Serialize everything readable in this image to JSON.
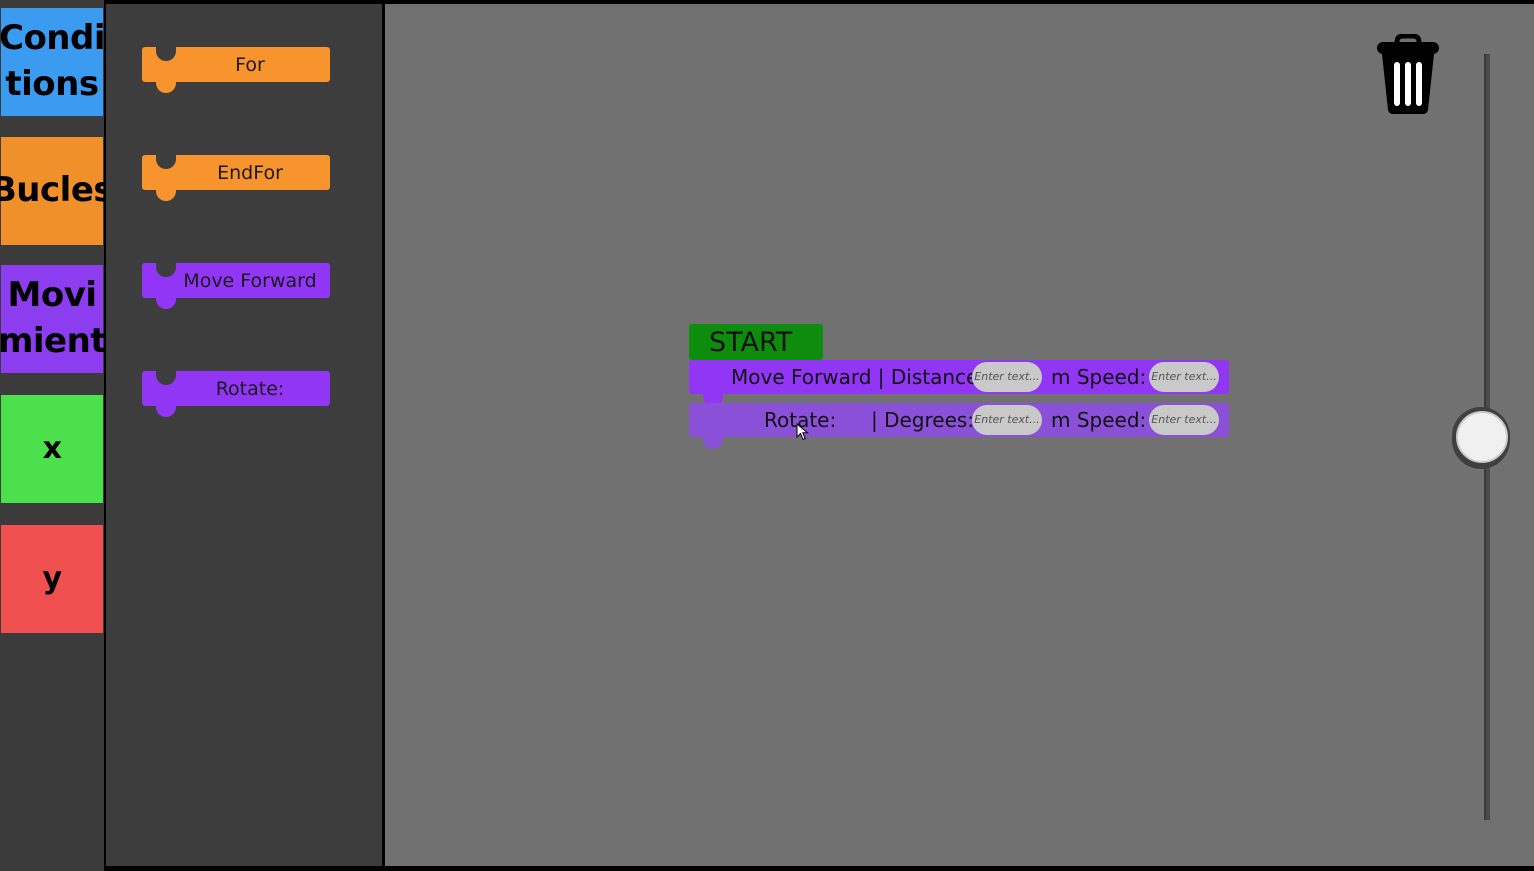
{
  "categories": [
    {
      "label": "Condi\ntions",
      "color": "#3a9bf0"
    },
    {
      "label": "Bucles",
      "color": "#f0902b"
    },
    {
      "label": "Movi\nmient",
      "color": "#8c3df0"
    },
    {
      "label": "x",
      "color": "#4ce04c"
    },
    {
      "label": "y",
      "color": "#f05050"
    }
  ],
  "palette": [
    {
      "label": "For",
      "color": "#f7942e"
    },
    {
      "label": "EndFor",
      "color": "#f7942e"
    },
    {
      "label": "Move Forward",
      "color": "#9136f5"
    },
    {
      "label": "Rotate:",
      "color": "#9136f5"
    }
  ],
  "program": {
    "start_label": "START",
    "start_color": "#0e8c0e",
    "move": {
      "label": "Move Forward | Distance:",
      "unit_speed": "m Speed:",
      "placeholder": "Enter text...",
      "color": "#9136f5"
    },
    "rotate": {
      "label": "Rotate:",
      "sep": "| Degrees:",
      "unit_speed": "m Speed:",
      "placeholder": "Enter text...",
      "color": "#8a50d8"
    }
  },
  "icons": {
    "trash": "trash-icon",
    "cursor": "mouse-pointer-icon"
  },
  "zoom_slider_value": 0.5
}
